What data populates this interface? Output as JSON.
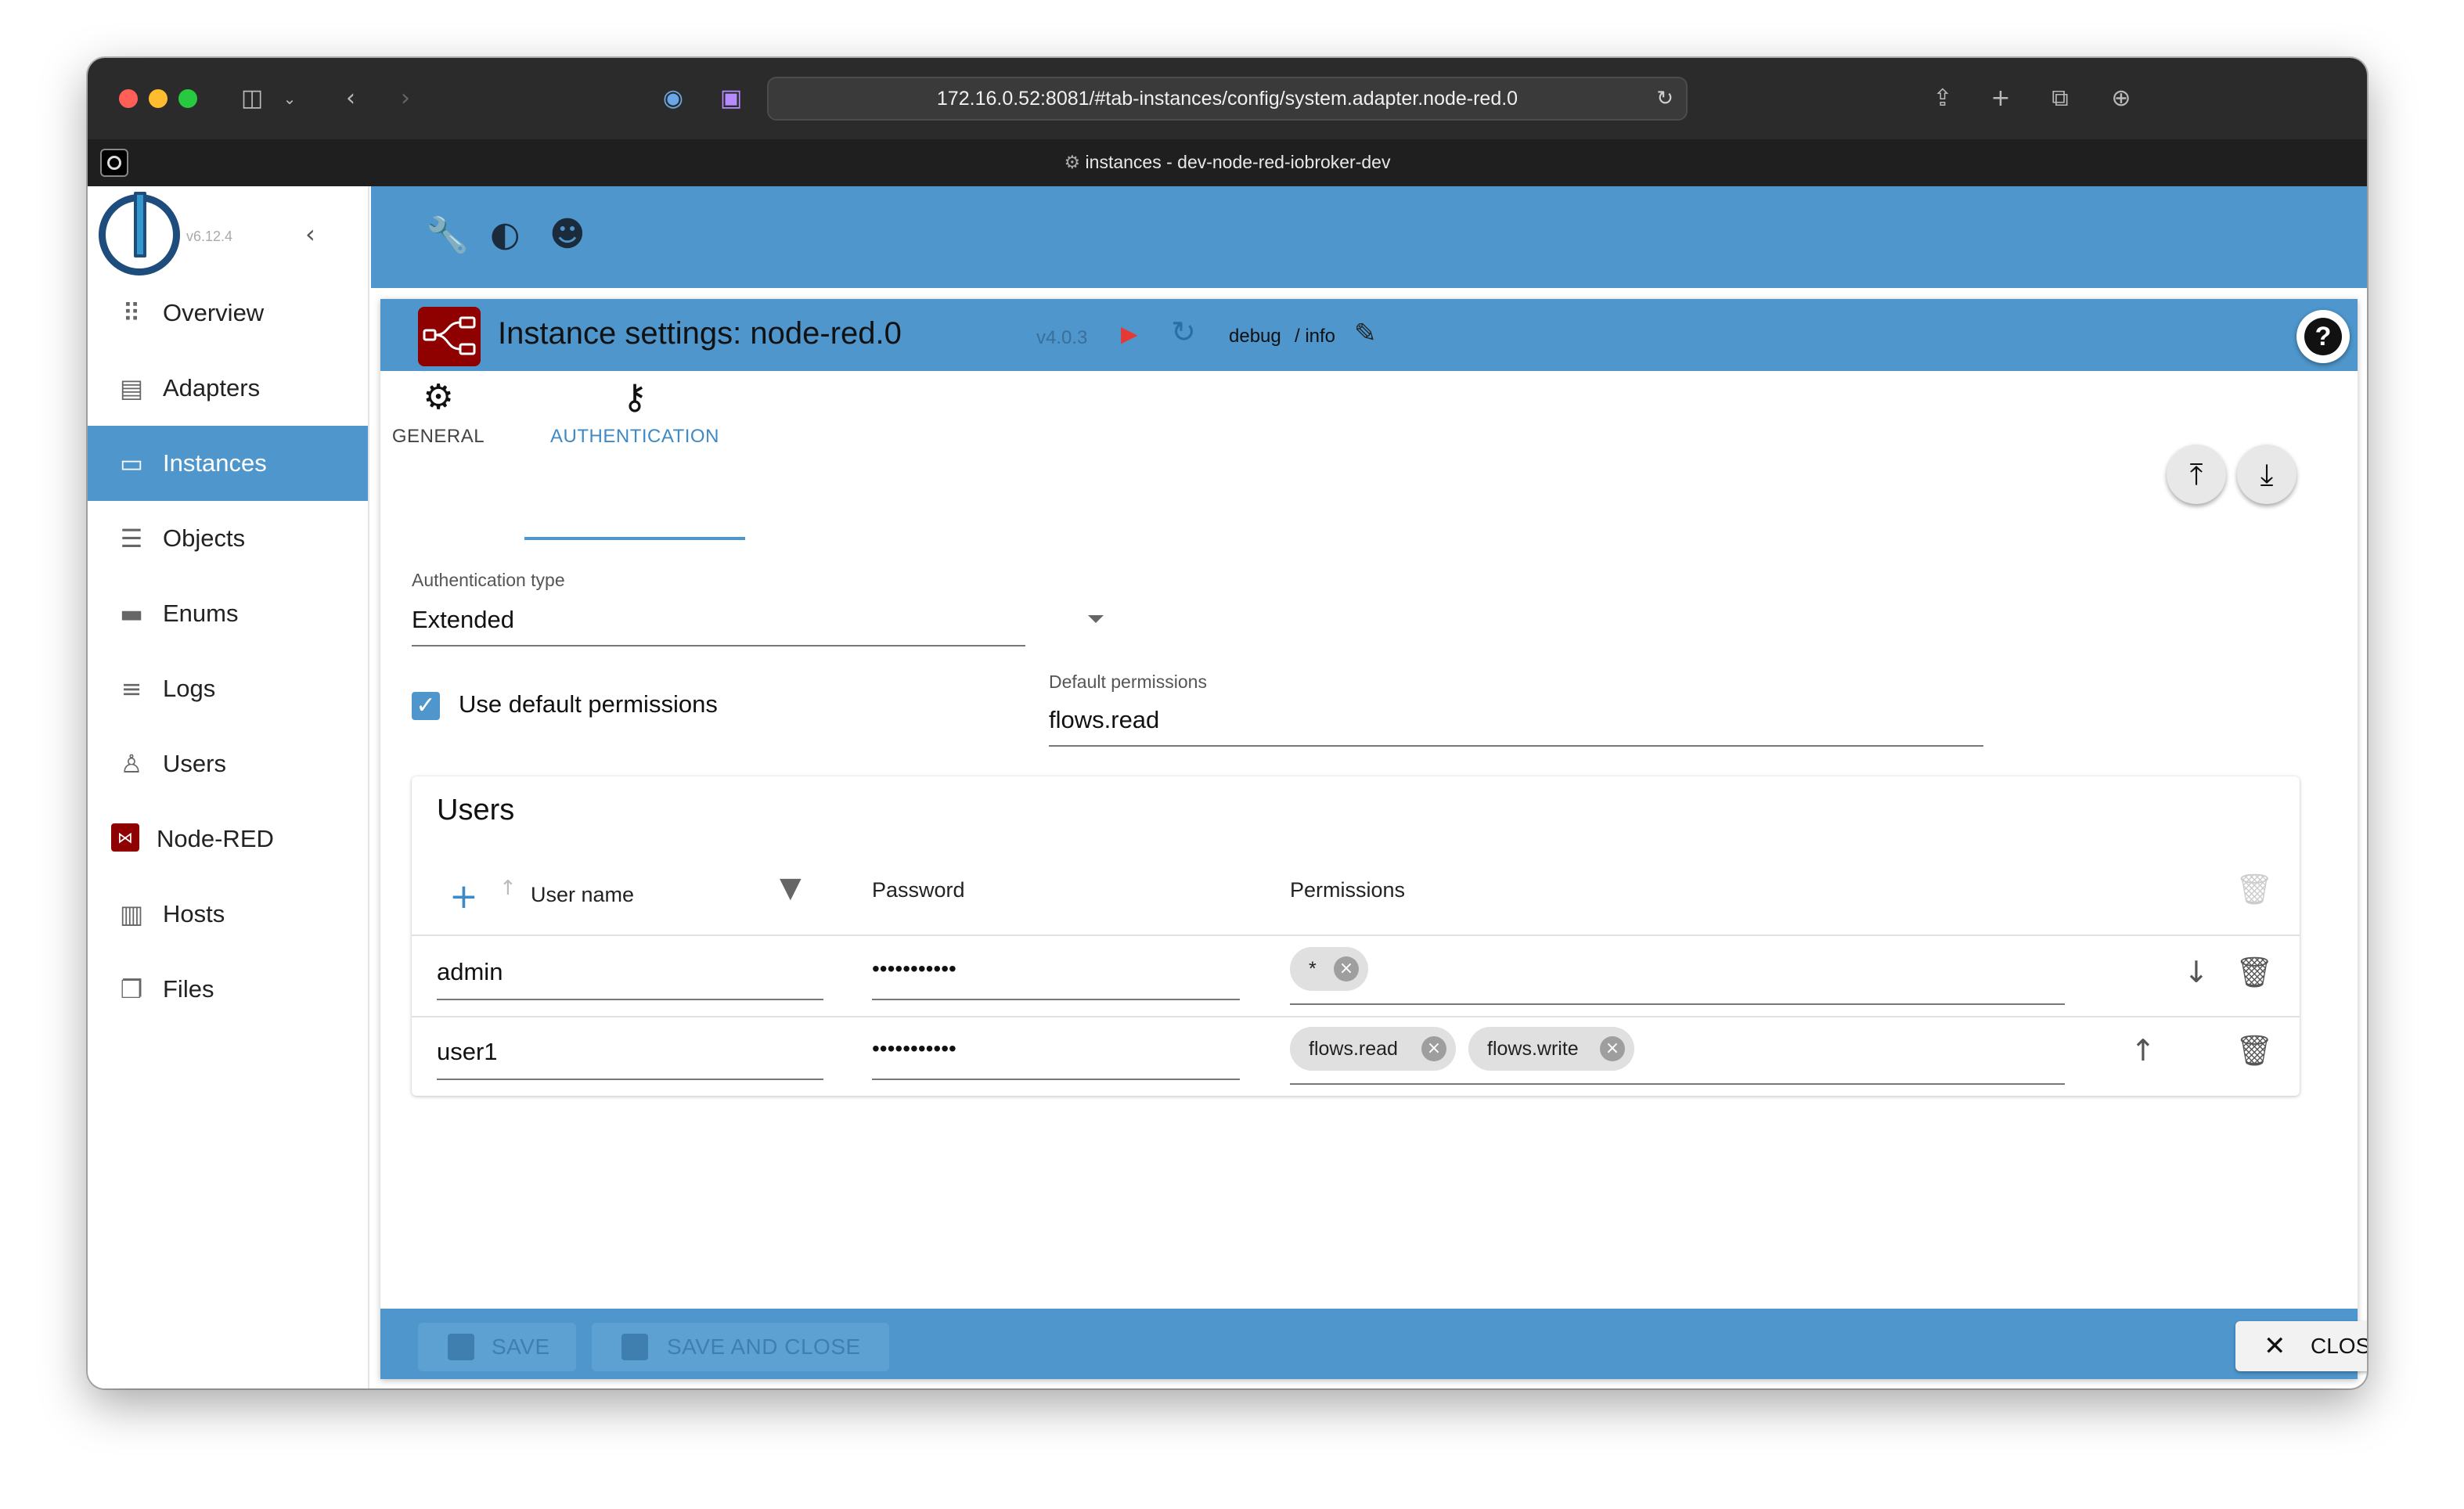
{
  "browser": {
    "url": "172.16.0.52:8081/#tab-instances/config/system.adapter.node-red.0",
    "tab_title": "instances - dev-node-red-iobroker-dev"
  },
  "sidebar": {
    "version": "v6.12.4",
    "items": [
      {
        "label": "Overview",
        "icon": "grid-icon"
      },
      {
        "label": "Adapters",
        "icon": "store-icon"
      },
      {
        "label": "Instances",
        "icon": "instances-icon",
        "active": true
      },
      {
        "label": "Objects",
        "icon": "list-icon"
      },
      {
        "label": "Enums",
        "icon": "enums-icon"
      },
      {
        "label": "Logs",
        "icon": "logs-icon"
      },
      {
        "label": "Users",
        "icon": "user-icon"
      },
      {
        "label": "Node-RED",
        "icon": "node-red-icon"
      },
      {
        "label": "Hosts",
        "icon": "hosts-icon"
      },
      {
        "label": "Files",
        "icon": "files-icon"
      }
    ]
  },
  "dialog": {
    "title": "Instance settings: node-red.0",
    "version": "v4.0.3",
    "log_level": "debug",
    "log_level_suffix": "/ info",
    "tabs": [
      {
        "label": "GENERAL",
        "icon": "gear-icon"
      },
      {
        "label": "AUTHENTICATION",
        "icon": "key-icon",
        "active": true
      }
    ],
    "auth_type_label": "Authentication type",
    "auth_type_value": "Extended",
    "use_default_label": "Use default permissions",
    "use_default_checked": true,
    "default_permissions_label": "Default permissions",
    "default_permissions_value": "flows.read",
    "users": {
      "title": "Users",
      "columns": [
        "User name",
        "Password",
        "Permissions"
      ],
      "rows": [
        {
          "username": "admin",
          "password": "•••••••••••",
          "permissions": [
            "*"
          ]
        },
        {
          "username": "user1",
          "password": "•••••••••••",
          "permissions": [
            "flows.read",
            "flows.write"
          ]
        }
      ]
    },
    "footer": {
      "save": "SAVE",
      "save_and_close": "SAVE AND CLOSE",
      "close": "CLOSE"
    }
  },
  "colors": {
    "accent": "#4e96cc",
    "node_red": "#8f0000"
  }
}
